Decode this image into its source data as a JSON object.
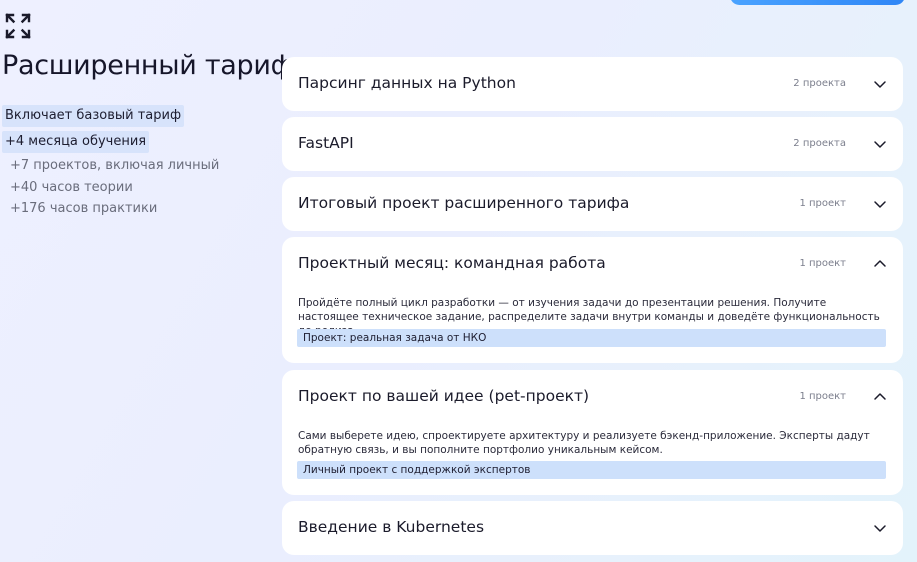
{
  "plan": {
    "title": "Расширенный тариф",
    "highlights": [
      "Включает базовый тариф",
      "+4 месяца обучения"
    ],
    "details": [
      "+7 проектов, включая личный",
      "+40 часов теории",
      "+176 часов практики"
    ]
  },
  "modules": [
    {
      "title": "Парсинг данных на Python",
      "count": "2 проекта",
      "expanded": false
    },
    {
      "title": "FastAPI",
      "count": "2 проекта",
      "expanded": false
    },
    {
      "title": "Итоговый проект расширенного тарифа",
      "count": "1 проект",
      "expanded": false
    },
    {
      "title": "Проектный месяц: командная работа",
      "count": "1 проект",
      "expanded": true,
      "description": "Пройдёте полный цикл разработки — от изучения задачи до презентации решения. Получите настоящее техническое задание, распределите задачи внутри команды и доведёте функциональность до релиза.",
      "tag": "Проект: реальная задача от НКО"
    },
    {
      "title": "Проект по вашей идее (pet-проект)",
      "count": "1 проект",
      "expanded": true,
      "description": "Сами выберете идею, спроектируете архитектуру и реализуете бэкенд-приложение. Эксперты дадут обратную связь, и вы пополните портфолио уникальным кейсом.",
      "tag": "Личный проект с поддержкой экспертов"
    },
    {
      "title": "Введение в Kubernetes",
      "count": "",
      "expanded": false
    }
  ],
  "icons": {
    "expand": "expand-arrows-icon",
    "collapsed": "chevron-down-icon",
    "expanded": "chevron-up-icon"
  },
  "colors": {
    "highlight": "#d7e3fb",
    "tag": "#cde0fb",
    "accent": "#2f86f6"
  }
}
